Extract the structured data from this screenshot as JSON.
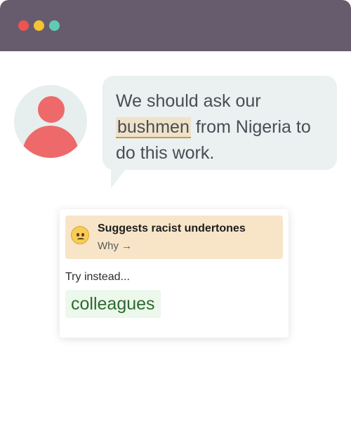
{
  "window": {
    "controls": [
      "close",
      "minimize",
      "maximize"
    ],
    "control_colors": [
      "#ef5350",
      "#f6c431",
      "#5fcdb4"
    ]
  },
  "message": {
    "avatar_icon": "person-icon",
    "before": "We should ask our",
    "flagged_word": "bushmen",
    "after": "from Nigeria to do this work."
  },
  "suggestion_card": {
    "emoji_icon": "worried-face-icon",
    "title": "Suggests racist undertones",
    "why_label": "Why →",
    "try_label": "Try instead...",
    "replacement": "colleagues"
  },
  "colors": {
    "titlebar": "#675c6e",
    "avatar": "#ee6a6a",
    "highlight": "#efe2c9",
    "alert_bg": "#f8e5c8",
    "suggestion_bg": "#ecf8ec",
    "suggestion_text": "#2d6a2f"
  }
}
